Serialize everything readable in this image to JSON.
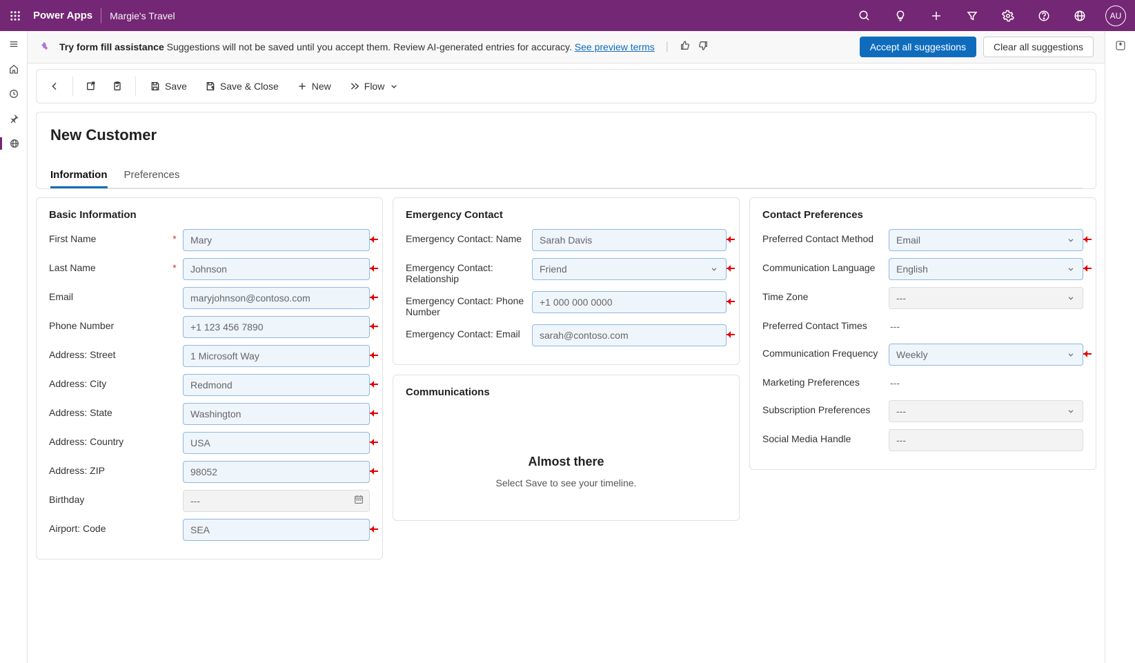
{
  "topbar": {
    "brand": "Power Apps",
    "appname": "Margie's Travel",
    "avatar": "AU"
  },
  "banner": {
    "title": "Try form fill assistance",
    "message": "Suggestions will not be saved until you accept them. Review AI-generated entries for accuracy.",
    "link": "See preview terms",
    "accept": "Accept all suggestions",
    "clear": "Clear all suggestions"
  },
  "cmdbar": {
    "save": "Save",
    "saveclose": "Save & Close",
    "new": "New",
    "flow": "Flow"
  },
  "page": {
    "title": "New Customer",
    "tabs": [
      "Information",
      "Preferences"
    ],
    "active_tab": 0
  },
  "sections": {
    "basic": {
      "title": "Basic Information",
      "fields": {
        "first_name": {
          "label": "First Name",
          "value": "Mary",
          "required": true,
          "suggested": true
        },
        "last_name": {
          "label": "Last Name",
          "value": "Johnson",
          "required": true,
          "suggested": true
        },
        "email": {
          "label": "Email",
          "value": "maryjohnson@contoso.com",
          "suggested": true
        },
        "phone": {
          "label": "Phone Number",
          "value": "+1 123 456 7890",
          "suggested": true
        },
        "street": {
          "label": "Address: Street",
          "value": "1 Microsoft Way",
          "suggested": true
        },
        "city": {
          "label": "Address: City",
          "value": "Redmond",
          "suggested": true
        },
        "state": {
          "label": "Address: State",
          "value": "Washington",
          "suggested": true
        },
        "country": {
          "label": "Address: Country",
          "value": "USA",
          "suggested": true
        },
        "zip": {
          "label": "Address: ZIP",
          "value": "98052",
          "suggested": true
        },
        "birthday": {
          "label": "Birthday",
          "value": "---"
        },
        "airport": {
          "label": "Airport: Code",
          "value": "SEA",
          "suggested": true
        }
      }
    },
    "emergency": {
      "title": "Emergency Contact",
      "fields": {
        "name": {
          "label": "Emergency Contact: Name",
          "value": "Sarah Davis",
          "suggested": true
        },
        "relationship": {
          "label": "Emergency Contact: Relationship",
          "value": "Friend",
          "suggested": true,
          "type": "select"
        },
        "phone": {
          "label": "Emergency Contact: Phone Number",
          "value": "+1 000 000 0000",
          "suggested": true
        },
        "email": {
          "label": "Emergency Contact: Email",
          "value": "sarah@contoso.com",
          "suggested": true
        }
      }
    },
    "communications": {
      "title": "Communications",
      "empty_title": "Almost there",
      "empty_msg": "Select Save to see your timeline."
    },
    "contact_prefs": {
      "title": "Contact Preferences",
      "fields": {
        "method": {
          "label": "Preferred Contact Method",
          "value": "Email",
          "suggested": true,
          "type": "select"
        },
        "language": {
          "label": "Communication Language",
          "value": "English",
          "suggested": true,
          "type": "select"
        },
        "timezone": {
          "label": "Time Zone",
          "value": "---",
          "type": "select"
        },
        "times": {
          "label": "Preferred Contact Times",
          "value": "---"
        },
        "frequency": {
          "label": "Communication Frequency",
          "value": "Weekly",
          "suggested": true,
          "type": "select"
        },
        "marketing": {
          "label": "Marketing Preferences",
          "value": "---"
        },
        "subscription": {
          "label": "Subscription Preferences",
          "value": "---",
          "type": "select"
        },
        "social": {
          "label": "Social Media Handle",
          "value": "---",
          "type": "input-plain"
        }
      }
    }
  }
}
